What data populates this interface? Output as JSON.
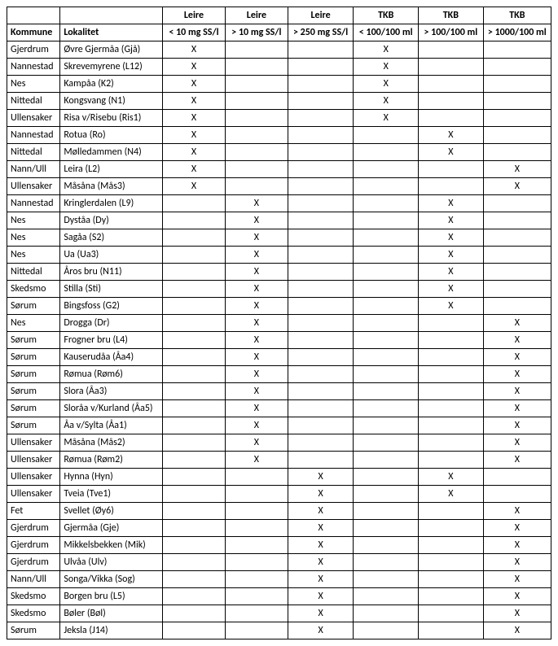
{
  "header_groups": [
    "Leire",
    "Leire",
    "Leire",
    "TKB",
    "TKB",
    "TKB"
  ],
  "header_row1_left": [
    "",
    ""
  ],
  "header_row2_left": [
    "Kommune",
    "Lokalitet"
  ],
  "header_thresholds": [
    "< 10 mg SS/l",
    "> 10 mg SS/l",
    "> 250 mg SS/l",
    "< 100/100 ml",
    "> 100/100 ml",
    "> 1000/100 ml"
  ],
  "rows": [
    {
      "kommune": "Gjerdrum",
      "lokalitet": "Øvre Gjermåa (Gjå)",
      "v": [
        "X",
        "",
        "",
        "X",
        "",
        ""
      ]
    },
    {
      "kommune": "Nannestad",
      "lokalitet": "Skrevemyrene (L12)",
      "v": [
        "X",
        "",
        "",
        "X",
        "",
        ""
      ]
    },
    {
      "kommune": "Nes",
      "lokalitet": "Kampåa (K2)",
      "v": [
        "X",
        "",
        "",
        "X",
        "",
        ""
      ]
    },
    {
      "kommune": "Nittedal",
      "lokalitet": "Kongsvang (N1)",
      "v": [
        "X",
        "",
        "",
        "X",
        "",
        ""
      ]
    },
    {
      "kommune": "Ullensaker",
      "lokalitet": "Risa v/Risebu (Ris1)",
      "v": [
        "X",
        "",
        "",
        "X",
        "",
        ""
      ]
    },
    {
      "kommune": "Nannestad",
      "lokalitet": "Rotua (Ro)",
      "v": [
        "X",
        "",
        "",
        "",
        "X",
        ""
      ]
    },
    {
      "kommune": "Nittedal",
      "lokalitet": "Mølledammen (N4)",
      "v": [
        "X",
        "",
        "",
        "",
        "X",
        ""
      ]
    },
    {
      "kommune": "Nann/Ull",
      "lokalitet": "Leira (L2)",
      "v": [
        "X",
        "",
        "",
        "",
        "",
        "X"
      ]
    },
    {
      "kommune": "Ullensaker",
      "lokalitet": "Måsåna (Mås3)",
      "v": [
        "X",
        "",
        "",
        "",
        "",
        "X"
      ]
    },
    {
      "kommune": "Nannestad",
      "lokalitet": "Kringlerdalen (L9)",
      "v": [
        "",
        "X",
        "",
        "",
        "X",
        ""
      ]
    },
    {
      "kommune": "Nes",
      "lokalitet": "Dyståa (Dy)",
      "v": [
        "",
        "X",
        "",
        "",
        "X",
        ""
      ]
    },
    {
      "kommune": "Nes",
      "lokalitet": "Sagåa (S2)",
      "v": [
        "",
        "X",
        "",
        "",
        "X",
        ""
      ]
    },
    {
      "kommune": "Nes",
      "lokalitet": "Ua (Ua3)",
      "v": [
        "",
        "X",
        "",
        "",
        "X",
        ""
      ]
    },
    {
      "kommune": "Nittedal",
      "lokalitet": "Åros bru (N11)",
      "v": [
        "",
        "X",
        "",
        "",
        "X",
        ""
      ]
    },
    {
      "kommune": "Skedsmo",
      "lokalitet": "Stilla (Sti)",
      "v": [
        "",
        "X",
        "",
        "",
        "X",
        ""
      ]
    },
    {
      "kommune": "Sørum",
      "lokalitet": "Bingsfoss (G2)",
      "v": [
        "",
        "X",
        "",
        "",
        "X",
        ""
      ]
    },
    {
      "kommune": "Nes",
      "lokalitet": "Drogga (Dr)",
      "v": [
        "",
        "X",
        "",
        "",
        "",
        "X"
      ]
    },
    {
      "kommune": "Sørum",
      "lokalitet": "Frogner bru (L4)",
      "v": [
        "",
        "X",
        "",
        "",
        "",
        "X"
      ]
    },
    {
      "kommune": "Sørum",
      "lokalitet": "Kauserudåa (Åa4)",
      "v": [
        "",
        "X",
        "",
        "",
        "",
        "X"
      ]
    },
    {
      "kommune": "Sørum",
      "lokalitet": "Rømua (Røm6)",
      "v": [
        "",
        "X",
        "",
        "",
        "",
        "X"
      ]
    },
    {
      "kommune": "Sørum",
      "lokalitet": "Slora (Åa3)",
      "v": [
        "",
        "X",
        "",
        "",
        "",
        "X"
      ]
    },
    {
      "kommune": "Sørum",
      "lokalitet": "Sloråa v/Kurland (Åa5)",
      "v": [
        "",
        "X",
        "",
        "",
        "",
        "X"
      ]
    },
    {
      "kommune": "Sørum",
      "lokalitet": "Åa v/Sylta (Åa1)",
      "v": [
        "",
        "X",
        "",
        "",
        "",
        "X"
      ]
    },
    {
      "kommune": "Ullensaker",
      "lokalitet": "Måsåna (Mås2)",
      "v": [
        "",
        "X",
        "",
        "",
        "",
        "X"
      ]
    },
    {
      "kommune": "Ullensaker",
      "lokalitet": "Rømua (Røm2)",
      "v": [
        "",
        "X",
        "",
        "",
        "",
        "X"
      ]
    },
    {
      "kommune": "Ullensaker",
      "lokalitet": "Hynna (Hyn)",
      "v": [
        "",
        "",
        "X",
        "",
        "X",
        ""
      ]
    },
    {
      "kommune": "Ullensaker",
      "lokalitet": "Tveia (Tve1)",
      "v": [
        "",
        "",
        "X",
        "",
        "X",
        ""
      ]
    },
    {
      "kommune": "Fet",
      "lokalitet": "Svellet (Øy6)",
      "v": [
        "",
        "",
        "X",
        "",
        "",
        "X"
      ]
    },
    {
      "kommune": "Gjerdrum",
      "lokalitet": "Gjermåa (Gje)",
      "v": [
        "",
        "",
        "X",
        "",
        "",
        "X"
      ]
    },
    {
      "kommune": "Gjerdrum",
      "lokalitet": "Mikkelsbekken (Mik)",
      "v": [
        "",
        "",
        "X",
        "",
        "",
        "X"
      ]
    },
    {
      "kommune": "Gjerdrum",
      "lokalitet": "Ulvåa (Ulv)",
      "v": [
        "",
        "",
        "X",
        "",
        "",
        "X"
      ]
    },
    {
      "kommune": "Nann/Ull",
      "lokalitet": "Songa/Vikka (Sog)",
      "v": [
        "",
        "",
        "X",
        "",
        "",
        "X"
      ]
    },
    {
      "kommune": "Skedsmo",
      "lokalitet": "Borgen bru (L5)",
      "v": [
        "",
        "",
        "X",
        "",
        "",
        "X"
      ]
    },
    {
      "kommune": "Skedsmo",
      "lokalitet": "Bøler (Bøl)",
      "v": [
        "",
        "",
        "X",
        "",
        "",
        "X"
      ]
    },
    {
      "kommune": "Sørum",
      "lokalitet": "Jeksla (J14)",
      "v": [
        "",
        "",
        "X",
        "",
        "",
        "X"
      ]
    }
  ]
}
